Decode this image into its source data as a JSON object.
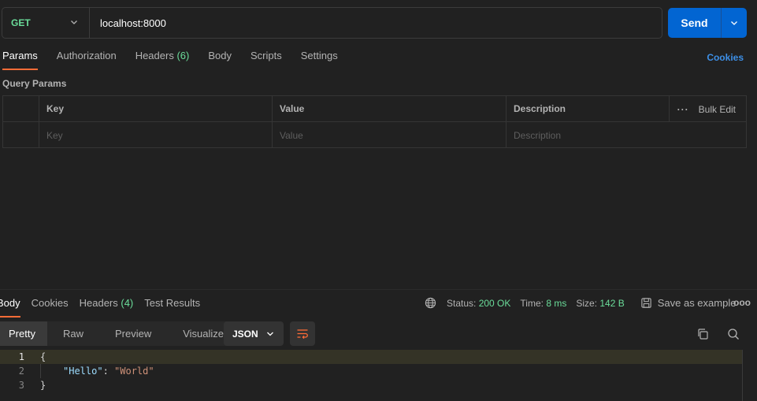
{
  "request": {
    "method": "GET",
    "url": "localhost:8000",
    "send_label": "Send"
  },
  "request_tabs": [
    {
      "label": "Params",
      "count": ""
    },
    {
      "label": "Authorization",
      "count": ""
    },
    {
      "label": "Headers",
      "count": "(6)"
    },
    {
      "label": "Body",
      "count": ""
    },
    {
      "label": "Scripts",
      "count": ""
    },
    {
      "label": "Settings",
      "count": ""
    }
  ],
  "cookies_label": "Cookies",
  "query_params": {
    "title": "Query Params",
    "headers": {
      "key": "Key",
      "value": "Value",
      "description": "Description"
    },
    "bulk_edit": "Bulk Edit",
    "placeholders": {
      "key": "Key",
      "value": "Value",
      "description": "Description"
    }
  },
  "response": {
    "tabs": [
      {
        "label": "Body",
        "count": ""
      },
      {
        "label": "Cookies",
        "count": ""
      },
      {
        "label": "Headers",
        "count": "(4)"
      },
      {
        "label": "Test Results",
        "count": ""
      }
    ],
    "status_label": "Status:",
    "status_value": "200 OK",
    "time_label": "Time:",
    "time_value": "8 ms",
    "size_label": "Size:",
    "size_value": "142 B",
    "save_example": "Save as example",
    "more": "ooo"
  },
  "view": {
    "modes": [
      "Pretty",
      "Raw",
      "Preview",
      "Visualize"
    ],
    "format": "JSON"
  },
  "editor": {
    "lines": [
      {
        "num": "1",
        "open": "{"
      },
      {
        "num": "2",
        "key": "\"Hello\"",
        "sep": ": ",
        "value": "\"World\""
      },
      {
        "num": "3",
        "close": "}"
      }
    ]
  },
  "colors": {
    "accent": "#ff6c37",
    "send_blue": "#0265d2",
    "method_green": "#6bdd9a",
    "link_blue": "#3d8fe6"
  }
}
